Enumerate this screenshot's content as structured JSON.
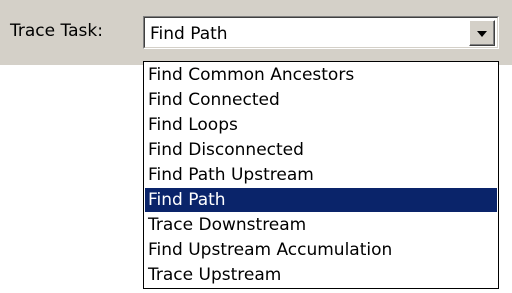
{
  "trace_task": {
    "label": "Trace Task:",
    "selected_value": "Find Path",
    "options": [
      "Find Common Ancestors",
      "Find Connected",
      "Find Loops",
      "Find Disconnected",
      "Find Path Upstream",
      "Find Path",
      "Trace Downstream",
      "Find Upstream Accumulation",
      "Trace Upstream"
    ],
    "highlighted_index": 5,
    "dropdown_icon": "chevron-down-icon"
  },
  "colors": {
    "toolbar_background": "#d4d0c8",
    "selection_background": "#0a246a",
    "selection_text": "#ffffff"
  }
}
